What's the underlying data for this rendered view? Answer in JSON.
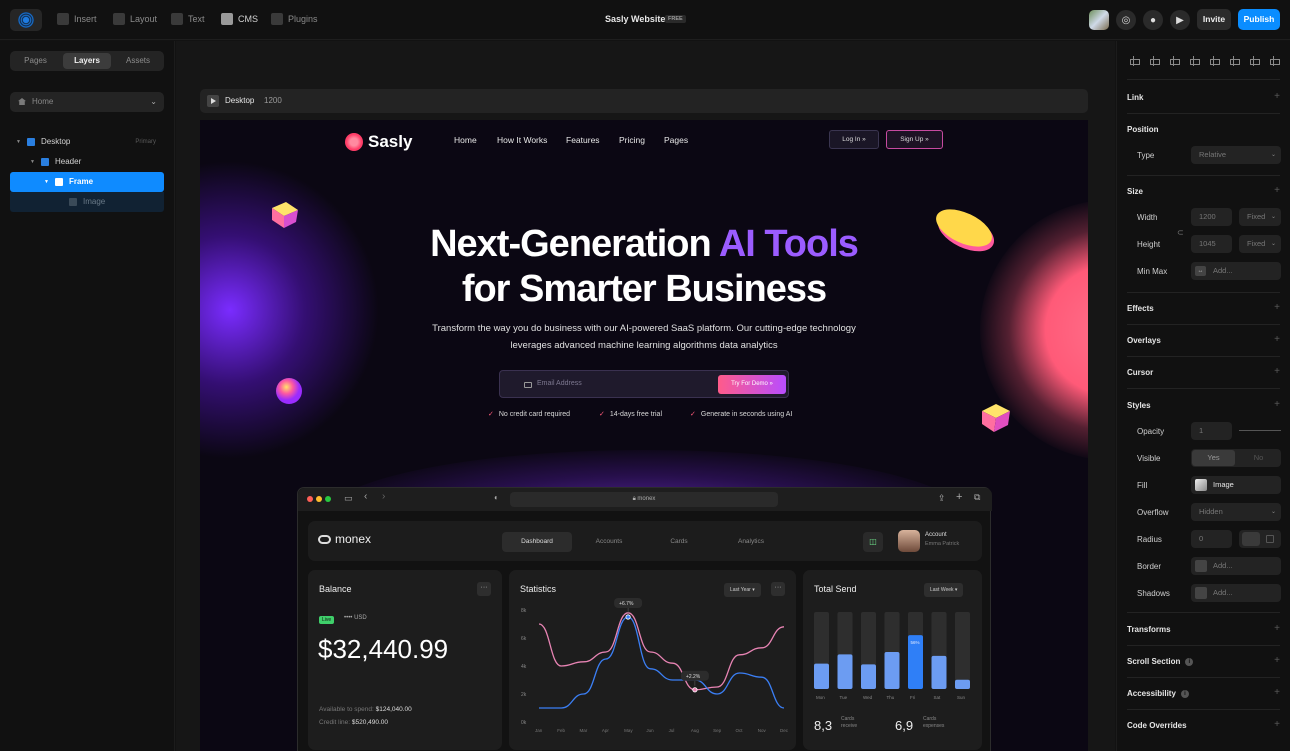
{
  "toolbar": {
    "insert_label": "Insert",
    "layout_label": "Layout",
    "text_label": "Text",
    "cms_label": "CMS",
    "plugins_label": "Plugins",
    "site_title": "Sasly Website",
    "plan_badge": "FREE",
    "invite_label": "Invite",
    "publish_label": "Publish",
    "accent_color": "#0a8dff"
  },
  "left_panel": {
    "tabs": [
      "Pages",
      "Layers",
      "Assets"
    ],
    "active_tab": "Layers",
    "page_select": "Home",
    "layers": [
      {
        "label": "Desktop",
        "tag": "Primary"
      },
      {
        "label": "Header"
      },
      {
        "label": "Frame",
        "selected": true
      },
      {
        "label": "Image"
      }
    ]
  },
  "canvas": {
    "frame_label": "Desktop",
    "frame_width_label": "1200"
  },
  "site": {
    "logo_text": "Sasly",
    "nav": [
      "Home",
      "How It Works",
      "Features",
      "Pricing",
      "Pages"
    ],
    "login_label": "Log In »",
    "signup_label": "Sign Up »",
    "hero_line1_a": "Next-Generation ",
    "hero_line1_b": "AI Tools",
    "hero_line2": "for Smarter Business",
    "subtext": "Transform the way you do business with our AI-powered SaaS platform. Our cutting-edge technology leverages advanced machine learning algorithms data analytics",
    "email_placeholder": "Email Address",
    "demo_button": "Try For Demo »",
    "checks": [
      "No credit card required",
      "14-days free trial",
      "Generate in seconds using AI"
    ],
    "brand_colors": {
      "pink": "#ff5b8a",
      "purple": "#9b5cff"
    }
  },
  "dashboard": {
    "url": "monex",
    "logo": "monex",
    "tabs": [
      "Dashboard",
      "Accounts",
      "Cards",
      "Analytics"
    ],
    "active_tab": "Dashboard",
    "account_title": "Account",
    "account_name": "Emma Patrick",
    "balance": {
      "title": "Balance",
      "badge": "Live",
      "masked": "•••• USD",
      "value": "$32,440.99",
      "available_label": "Available to spend:",
      "available_value": "$124,040.00",
      "credit_label": "Credit line:",
      "credit_value": "$520,490.00"
    },
    "statistics": {
      "title": "Statistics",
      "range": "Last Year",
      "y_ticks": [
        "8k",
        "6k",
        "4k",
        "2k",
        "0k"
      ],
      "x_ticks": [
        "Jan",
        "Feb",
        "Mar",
        "Apr",
        "May",
        "Jun",
        "Jul",
        "Aug",
        "Sep",
        "Oct",
        "Nov",
        "Dec"
      ],
      "tooltip_1": "+6.7%",
      "tooltip_2": "+2.2%"
    },
    "total_send": {
      "title": "Total Send",
      "range": "Last Week",
      "days": [
        "Mon",
        "Tue",
        "Wed",
        "Thu",
        "Fri",
        "Sat",
        "Sun"
      ],
      "active_day_label": "56%",
      "cards_value": "8,3",
      "cards_label": "Cards\nreceive",
      "expenses_value": "6,9",
      "expenses_label": "Cards\nexpenses"
    }
  },
  "chart_data": {
    "type": "line",
    "x": [
      "Jan",
      "Feb",
      "Mar",
      "Apr",
      "May",
      "Jun",
      "Jul",
      "Aug",
      "Sep",
      "Oct",
      "Nov",
      "Dec"
    ],
    "series": [
      {
        "values": [
          7.0,
          4.0,
          4.3,
          5.0,
          7.8,
          5.0,
          4.2,
          2.3,
          2.5,
          4.8,
          5.3,
          6.8
        ]
      },
      {
        "values": [
          1.0,
          1.0,
          2.0,
          4.5,
          7.5,
          3.8,
          3.0,
          3.0,
          2.0,
          3.5,
          3.2,
          1.0
        ]
      }
    ],
    "ylim": [
      0,
      8
    ],
    "bar_levels": [
      0.33,
      0.45,
      0.32,
      0.48,
      0.7,
      0.43,
      0.12
    ]
  },
  "right_panel": {
    "sections": {
      "link": "Link",
      "position": "Position",
      "size": "Size",
      "effects": "Effects",
      "overlays": "Overlays",
      "cursor": "Cursor",
      "styles": "Styles",
      "transforms": "Transforms",
      "scroll_section": "Scroll Section",
      "accessibility": "Accessibility",
      "code_overrides": "Code Overrides"
    },
    "type_label": "Type",
    "type_value": "Relative",
    "width_label": "Width",
    "width_value": "1200",
    "width_mode": "Fixed",
    "height_label": "Height",
    "height_value": "1045",
    "height_mode": "Fixed",
    "minmax_label": "Min Max",
    "minmax_placeholder": "Add...",
    "opacity_label": "Opacity",
    "opacity_value": "1",
    "visible_label": "Visible",
    "visible_yes": "Yes",
    "visible_no": "No",
    "fill_label": "Fill",
    "fill_value": "Image",
    "overflow_label": "Overflow",
    "overflow_value": "Hidden",
    "radius_label": "Radius",
    "radius_value": "0",
    "border_label": "Border",
    "border_placeholder": "Add...",
    "shadows_label": "Shadows",
    "shadows_placeholder": "Add..."
  }
}
